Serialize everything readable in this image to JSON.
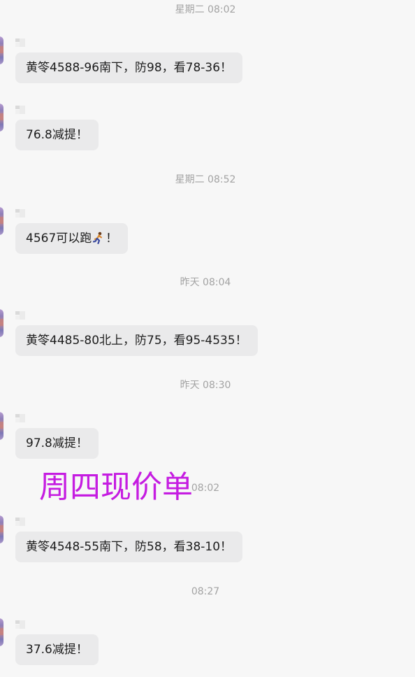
{
  "chat": {
    "entries": [
      {
        "type": "timestamp",
        "text": "星期二 08:02"
      },
      {
        "type": "message",
        "text": "黄笭4588-96南下，防98，看78-36！"
      },
      {
        "type": "message",
        "text": "76.8减提！"
      },
      {
        "type": "timestamp",
        "text": "星期二 08:52"
      },
      {
        "type": "message",
        "text_before": "4567可以跑",
        "emoji": "running-person-icon",
        "text_after": "！"
      },
      {
        "type": "timestamp",
        "text": "昨天 08:04"
      },
      {
        "type": "message",
        "text": "黄笭4485-80北上，防75，看95-4535！"
      },
      {
        "type": "timestamp",
        "text": "昨天 08:30"
      },
      {
        "type": "message",
        "text": "97.8减提！"
      },
      {
        "type": "timestamp",
        "text": "08:02"
      },
      {
        "type": "message",
        "text": "黄笭4548-55南下，防58，看38-10！"
      },
      {
        "type": "timestamp",
        "text": "08:27"
      },
      {
        "type": "message",
        "text": "37.6减提！"
      }
    ]
  },
  "overlay": {
    "text": "周四现价单",
    "color": "#c51ce1"
  },
  "colors": {
    "background": "#f7f7f7",
    "bubble": "#eaeaeb",
    "timestamp": "#a3a3a3",
    "text": "#1c1c1c"
  }
}
